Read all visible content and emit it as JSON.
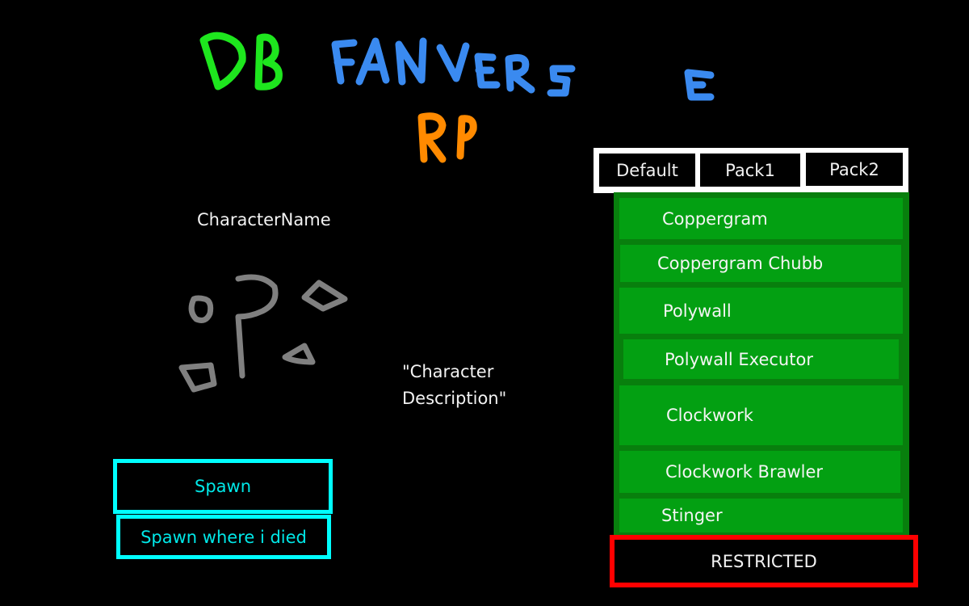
{
  "title": {
    "line1_part1": "DB",
    "line1_part2": "FANVERSE",
    "line2": "RP",
    "colors": {
      "db": "#1ee61e",
      "fanverse": "#3a8af0",
      "rp": "#ff8a00"
    }
  },
  "character": {
    "name": "CharacterName",
    "description": "\"Character Description\"",
    "portrait_icon": "scribbled-shapes-placeholder"
  },
  "buttons": {
    "spawn": "Spawn",
    "spawn_where_died": "Spawn where i died",
    "restricted": "RESTRICTED"
  },
  "pack_tabs": [
    {
      "label": "Default"
    },
    {
      "label": "Pack1"
    },
    {
      "label": "Pack2"
    }
  ],
  "character_list": [
    {
      "label": "Coppergram"
    },
    {
      "label": "Coppergram Chubb"
    },
    {
      "label": "Polywall"
    },
    {
      "label": "Polywall Executor"
    },
    {
      "label": "Clockwork"
    },
    {
      "label": "Clockwork Brawler"
    },
    {
      "label": "Stinger"
    }
  ],
  "colors": {
    "accent_cyan": "#00ffff",
    "list_green": "#03a012",
    "list_border_green": "#087f0d",
    "restricted_red": "#ff0000"
  }
}
